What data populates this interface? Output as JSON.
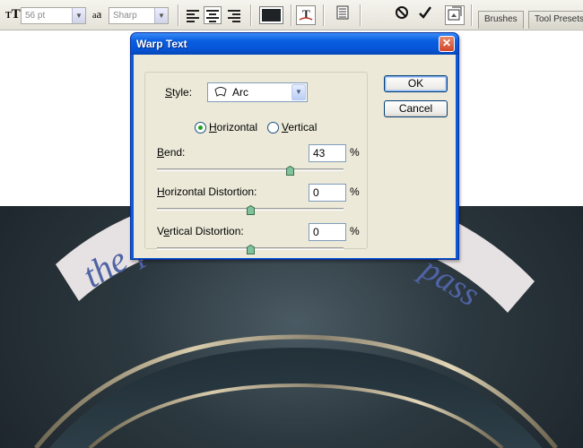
{
  "optionsbar": {
    "font_size": "56 pt",
    "antialias": "Sharp",
    "tool_icons": [
      "type-tool-icon",
      "antialias-icon",
      "align-left-icon",
      "align-center-icon",
      "align-right-icon",
      "text-color-swatch",
      "warp-text-icon",
      "character-panel-icon",
      "cancel-icon",
      "commit-icon",
      "palette-well-icon"
    ],
    "panel_tabs": [
      "Brushes",
      "Tool Presets"
    ]
  },
  "canvas": {
    "ribbon_text_left": "the p",
    "ribbon_text_right": "pass",
    "colors": {
      "background": "#2c383f",
      "ribbon": "#e6e1e2",
      "ribbon_text": "#4f63a5",
      "ring_metal": "#b8aa8a"
    }
  },
  "dialog": {
    "title": "Warp Text",
    "close_icon": "close-icon",
    "style_label": "Style:",
    "style_value": "Arc",
    "style_icon": "arc-style-icon",
    "orientation": {
      "horizontal": "Horizontal",
      "vertical": "Vertical",
      "selected": "Horizontal"
    },
    "bend": {
      "label": "Bend:",
      "value": "43",
      "unit": "%",
      "slider_fraction": 0.715
    },
    "horizontal_distortion": {
      "label": "Horizontal Distortion:",
      "value": "0",
      "unit": "%",
      "slider_fraction": 0.5
    },
    "vertical_distortion": {
      "label": "Vertical Distortion:",
      "value": "0",
      "unit": "%",
      "slider_fraction": 0.5
    },
    "ok_label": "OK",
    "cancel_label": "Cancel"
  }
}
